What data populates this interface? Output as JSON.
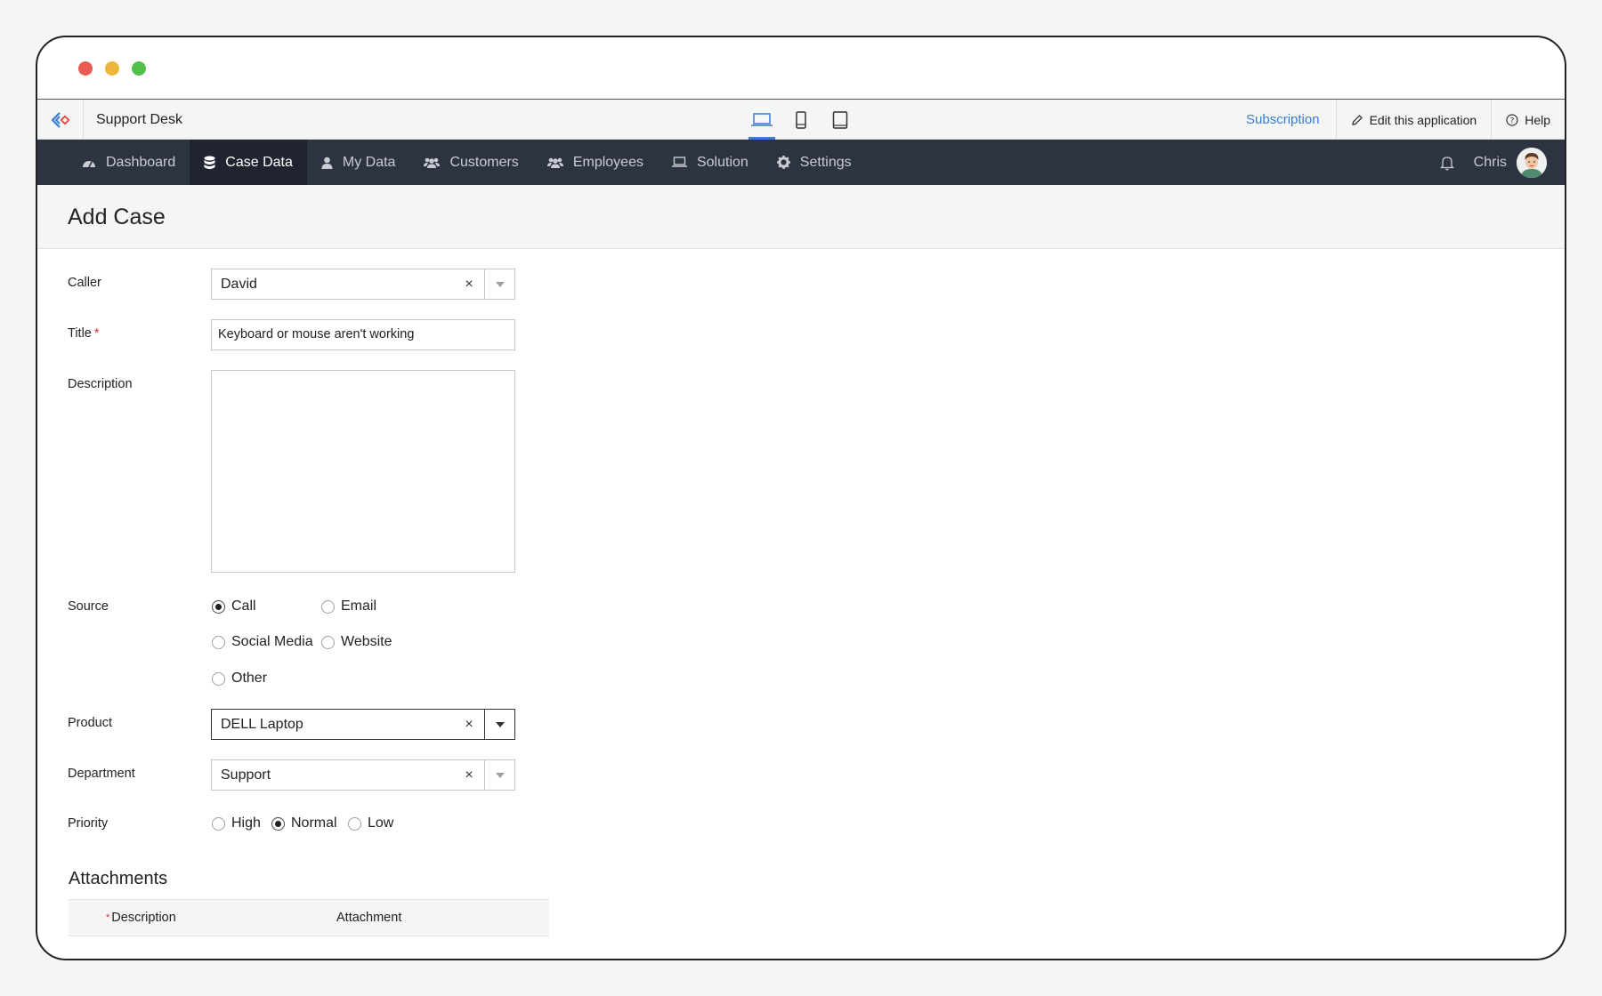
{
  "app": {
    "name": "Support Desk",
    "subscription_label": "Subscription",
    "edit_label": "Edit this application",
    "help_label": "Help"
  },
  "devices": [
    "laptop-icon",
    "phone-icon",
    "tablet-icon"
  ],
  "nav": {
    "items": [
      {
        "label": "Dashboard",
        "icon": "dashboard-icon"
      },
      {
        "label": "Case Data",
        "icon": "database-icon",
        "active": true
      },
      {
        "label": "My Data",
        "icon": "user-icon"
      },
      {
        "label": "Customers",
        "icon": "users-icon"
      },
      {
        "label": "Employees",
        "icon": "users-icon"
      },
      {
        "label": "Solution",
        "icon": "laptop-icon"
      },
      {
        "label": "Settings",
        "icon": "gear-icon"
      }
    ],
    "user_name": "Chris"
  },
  "page": {
    "title": "Add Case"
  },
  "form": {
    "caller": {
      "label": "Caller",
      "value": "David"
    },
    "title": {
      "label": "Title",
      "required_mark": "*",
      "value": "Keyboard or mouse aren't working"
    },
    "description": {
      "label": "Description",
      "value": ""
    },
    "source": {
      "label": "Source",
      "options": [
        "Call",
        "Email",
        "Social Media",
        "Website",
        "Other"
      ],
      "selected": "Call"
    },
    "product": {
      "label": "Product",
      "value": "DELL Laptop"
    },
    "department": {
      "label": "Department",
      "value": "Support"
    },
    "priority": {
      "label": "Priority",
      "options": [
        "High",
        "Normal",
        "Low"
      ],
      "selected": "Normal"
    },
    "clear_symbol": "×"
  },
  "attachments": {
    "title": "Attachments",
    "columns": [
      "Description",
      "Attachment"
    ],
    "required_mark": "*"
  },
  "colors": {
    "navbar": "#2d3341",
    "nav_active": "#1f2430",
    "link": "#3b7bd0",
    "required": "#d9342b"
  }
}
